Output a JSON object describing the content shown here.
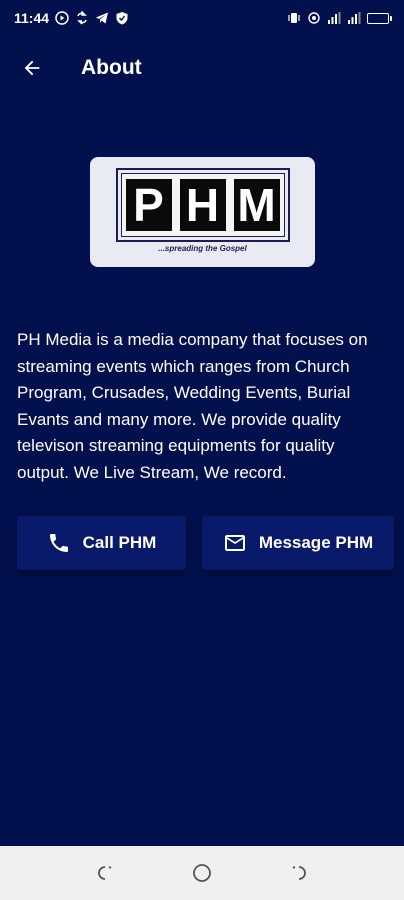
{
  "status_bar": {
    "time": "11:44",
    "battery_level": 0.95
  },
  "app_bar": {
    "title": "About",
    "back_icon": "arrow-left-icon"
  },
  "logo": {
    "letters": [
      "P",
      "H",
      "M"
    ],
    "tagline": "...spreading the Gospel"
  },
  "description": "PH Media is a media company that focuses on streaming events which ranges from Church Program, Crusades, Wedding Events, Burial Evants and many more. We provide quality televison streaming equipments for quality output. We Live Stream, We record.",
  "actions": {
    "call_label": "Call PHM",
    "call_icon": "phone-icon",
    "message_label": "Message PHM",
    "message_icon": "mail-icon"
  },
  "colors": {
    "background": "#03104e",
    "button": "#0a1a6b",
    "nav_bar": "#f0f0f2"
  }
}
